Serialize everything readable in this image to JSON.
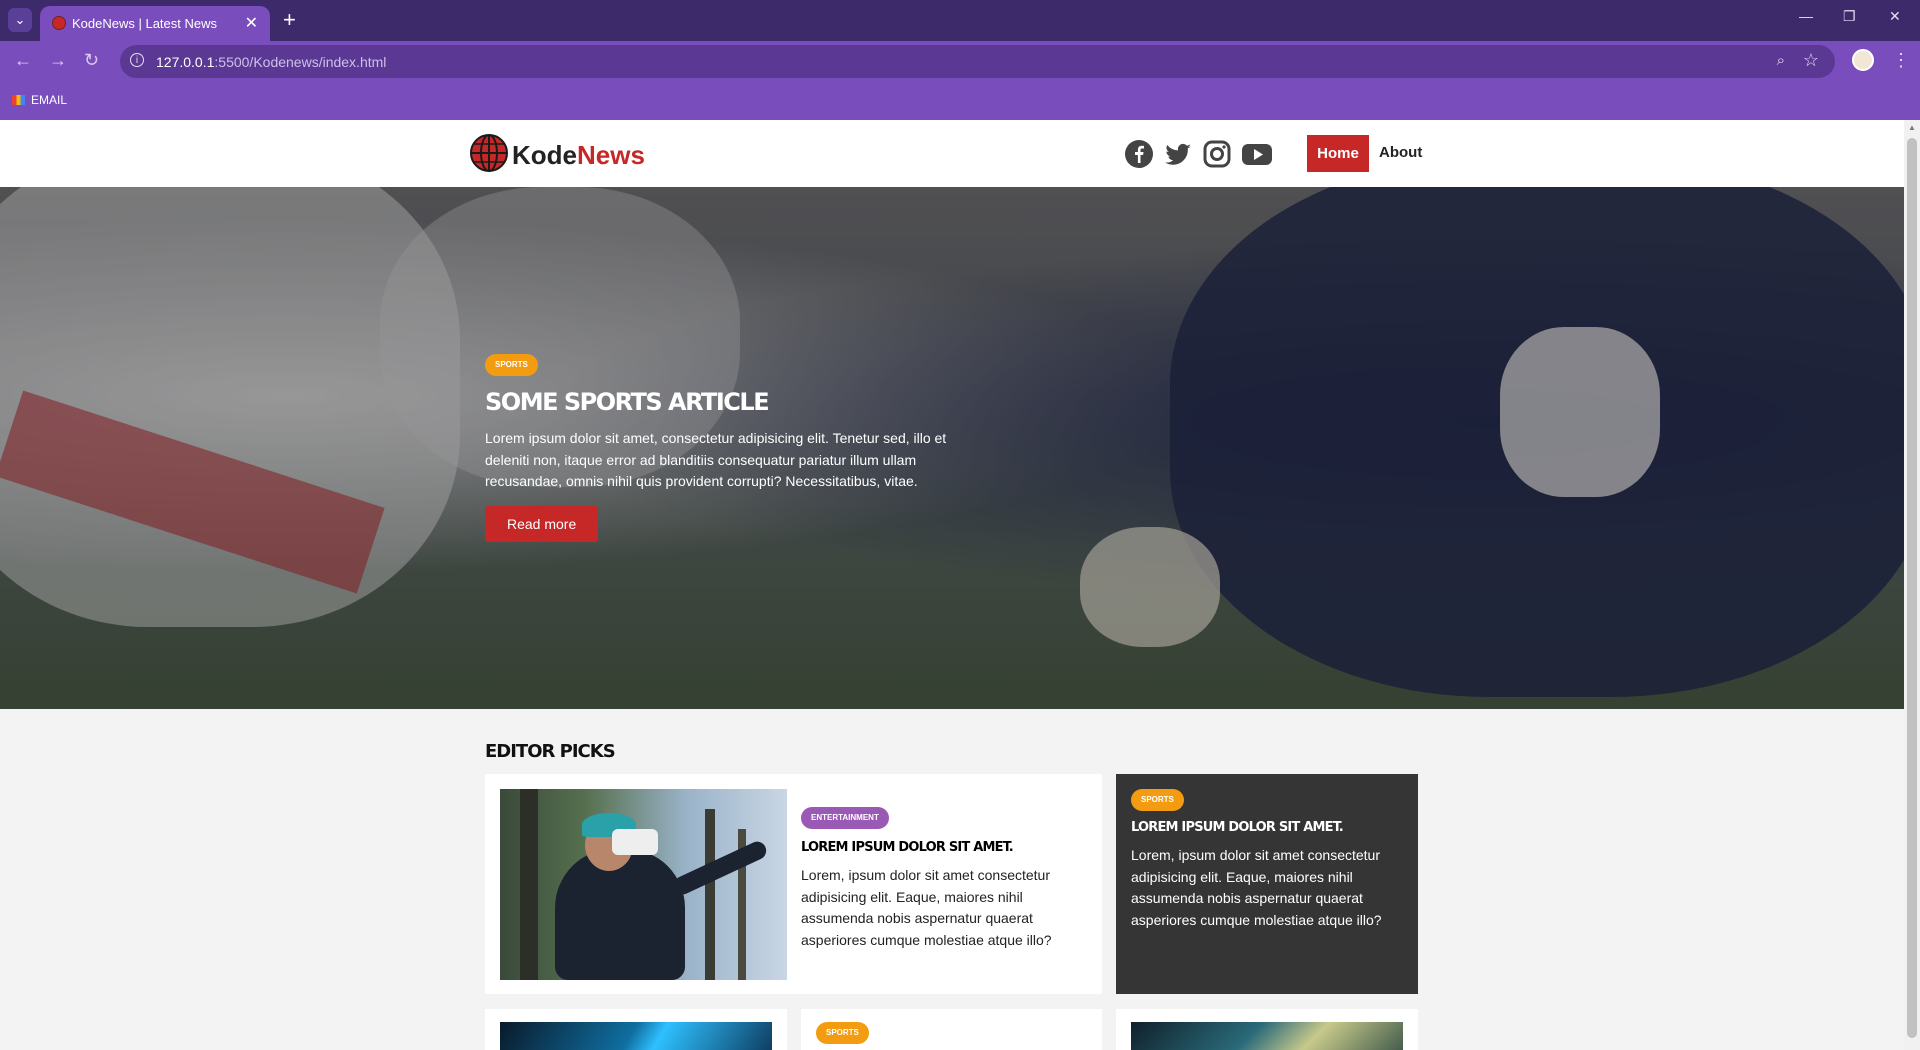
{
  "browser": {
    "tab_title": "KodeNews | Latest News",
    "url_host": "127.0.0.1",
    "url_rest": ":5500/Kodenews/index.html",
    "bookmark": "EMAIL"
  },
  "header": {
    "brand_part1": "Kode",
    "brand_part2": "News",
    "nav": {
      "home": "Home",
      "about": "About"
    },
    "social_icons": [
      "facebook-icon",
      "twitter-icon",
      "instagram-icon",
      "youtube-icon"
    ]
  },
  "hero": {
    "category": "SPORTS",
    "title": "SOME SPORTS ARTICLE",
    "text": "Lorem ipsum dolor sit amet, consectetur adipisicing elit. Tenetur sed, illo et deleniti non, itaque error ad blanditiis consequatur pariatur illum ullam recusandae, omnis nihil quis provident corrupti? Necessitatibus, vitae.",
    "button": "Read more"
  },
  "editor_picks": {
    "title": "EDITOR PICKS",
    "cards": [
      {
        "category": "ENTERTAINMENT",
        "title": "LOREM IPSUM DOLOR SIT AMET.",
        "text": "Lorem, ipsum dolor sit amet consectetur adipisicing elit. Eaque, maiores nihil assumenda nobis aspernatur quaerat asperiores cumque molestiae atque illo?"
      },
      {
        "category": "SPORTS",
        "title": "LOREM IPSUM DOLOR SIT AMET.",
        "text": "Lorem, ipsum dolor sit amet consectetur adipisicing elit. Eaque, maiores nihil assumenda nobis aspernatur quaerat asperiores cumque molestiae atque illo?"
      },
      {
        "category": "SPORTS"
      }
    ]
  },
  "colors": {
    "brand_red": "#c62828",
    "sports_badge": "#f39c12",
    "entertainment_badge": "#9b59b6",
    "browser_frame": "#7a4dbc"
  }
}
